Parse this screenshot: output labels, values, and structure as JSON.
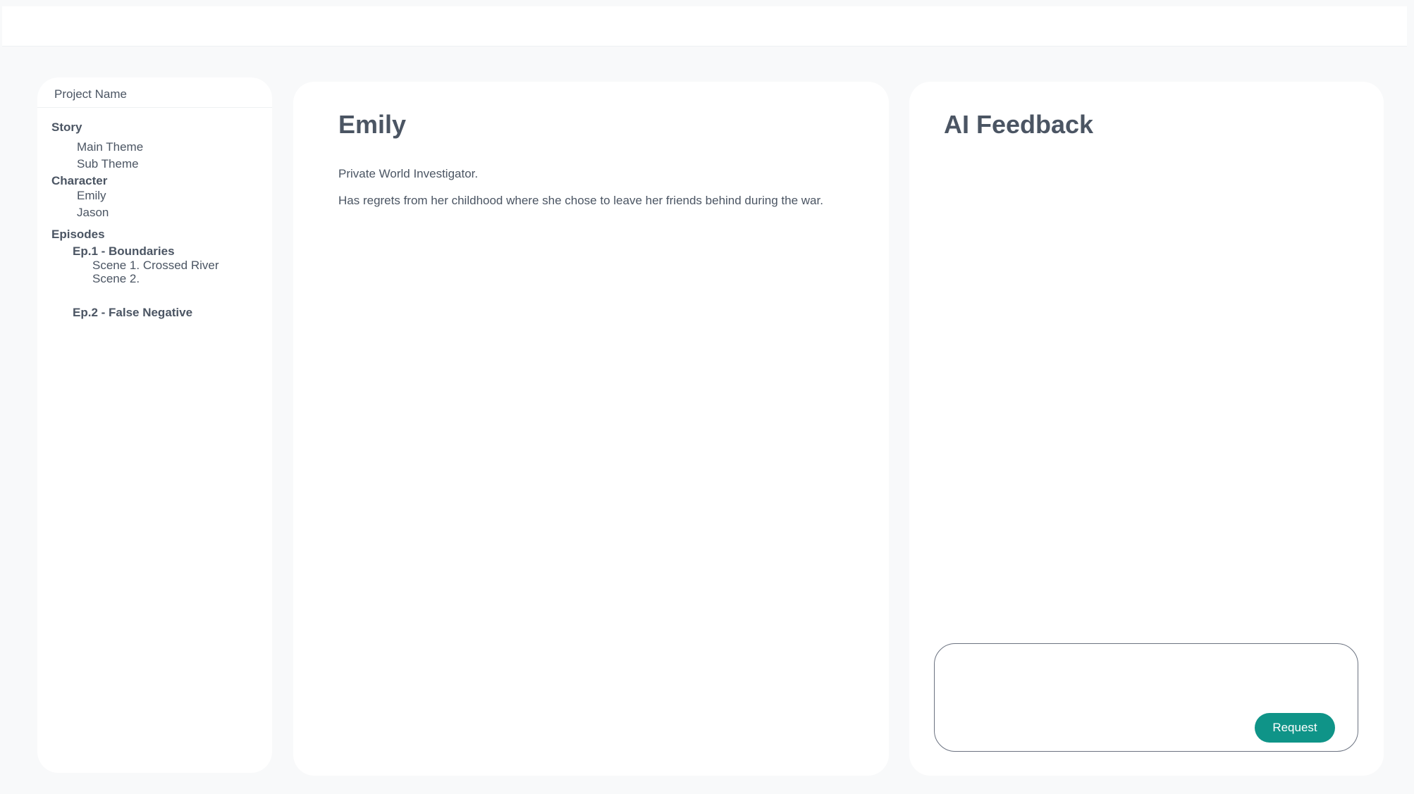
{
  "sidebar": {
    "project_name": "Project Name",
    "story": {
      "label": "Story",
      "items": [
        "Main Theme",
        "Sub Theme"
      ]
    },
    "character": {
      "label": "Character",
      "items": [
        "Emily",
        "Jason"
      ]
    },
    "episodes": {
      "label": "Episodes",
      "list": [
        {
          "label": "Ep.1 - Boundaries",
          "scenes": [
            "Scene 1. Crossed River",
            "Scene 2."
          ]
        },
        {
          "label": "Ep.2 - False Negative",
          "scenes": []
        }
      ]
    }
  },
  "main": {
    "title": "Emily",
    "lines": [
      "Private World Investigator.",
      "Has regrets from her childhood where she chose to leave her friends behind during the war."
    ]
  },
  "ai_feedback": {
    "title": "AI Feedback",
    "input_value": "",
    "button_label": "Request",
    "accent_color": "#0f9488"
  }
}
